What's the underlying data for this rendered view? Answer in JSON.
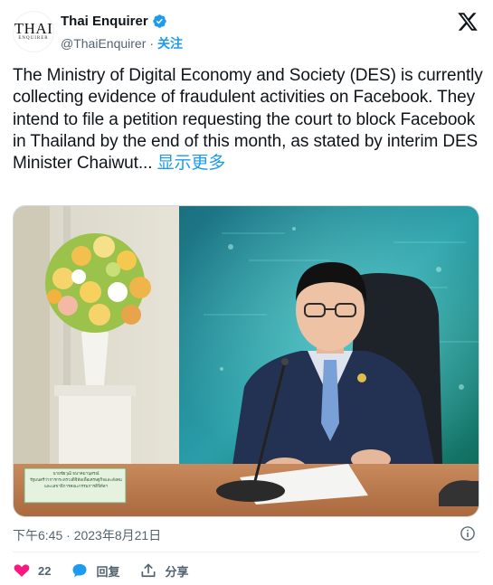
{
  "author": {
    "display_name": "Thai Enquirer",
    "handle": "@ThaiEnquirer",
    "separator": "·",
    "follow_label": "关注",
    "avatar_logo_main": "THAI",
    "avatar_logo_sub": "ENQUIRER",
    "verified_color": "#1d9bf0"
  },
  "tweet": {
    "text": "The Ministry of Digital Economy and Society (DES) is currently collecting evidence of fraudulent activities on Facebook. They intend to file a petition requesting the court to block Facebook in Thailand by the end of this month, as stated by interim DES Minister Chaiwut...",
    "show_more_label": "显示更多",
    "timestamp": "下午6:45 · 2023年8月21日"
  },
  "photo": {
    "nameplate_line1": "นายชัยวุฒิ ธนาคมานุสรณ์",
    "nameplate_line2": "รัฐมนตรีว่าการกระทรวงดิจิทัลเพื่อเศรษฐกิจและสังคม",
    "nameplate_line3": "และเลขาธิการคณะกรรมการดิจิทัลฯ"
  },
  "actions": {
    "like_count": "22",
    "reply_label": "回复",
    "share_label": "分享",
    "like_color": "#f91880",
    "reply_color": "#1d9bf0"
  },
  "icons": {
    "x_logo": "x-logo-icon",
    "verified": "verified-badge-icon",
    "info": "info-icon",
    "like": "heart-icon",
    "reply": "speech-bubble-icon",
    "share": "share-icon"
  }
}
